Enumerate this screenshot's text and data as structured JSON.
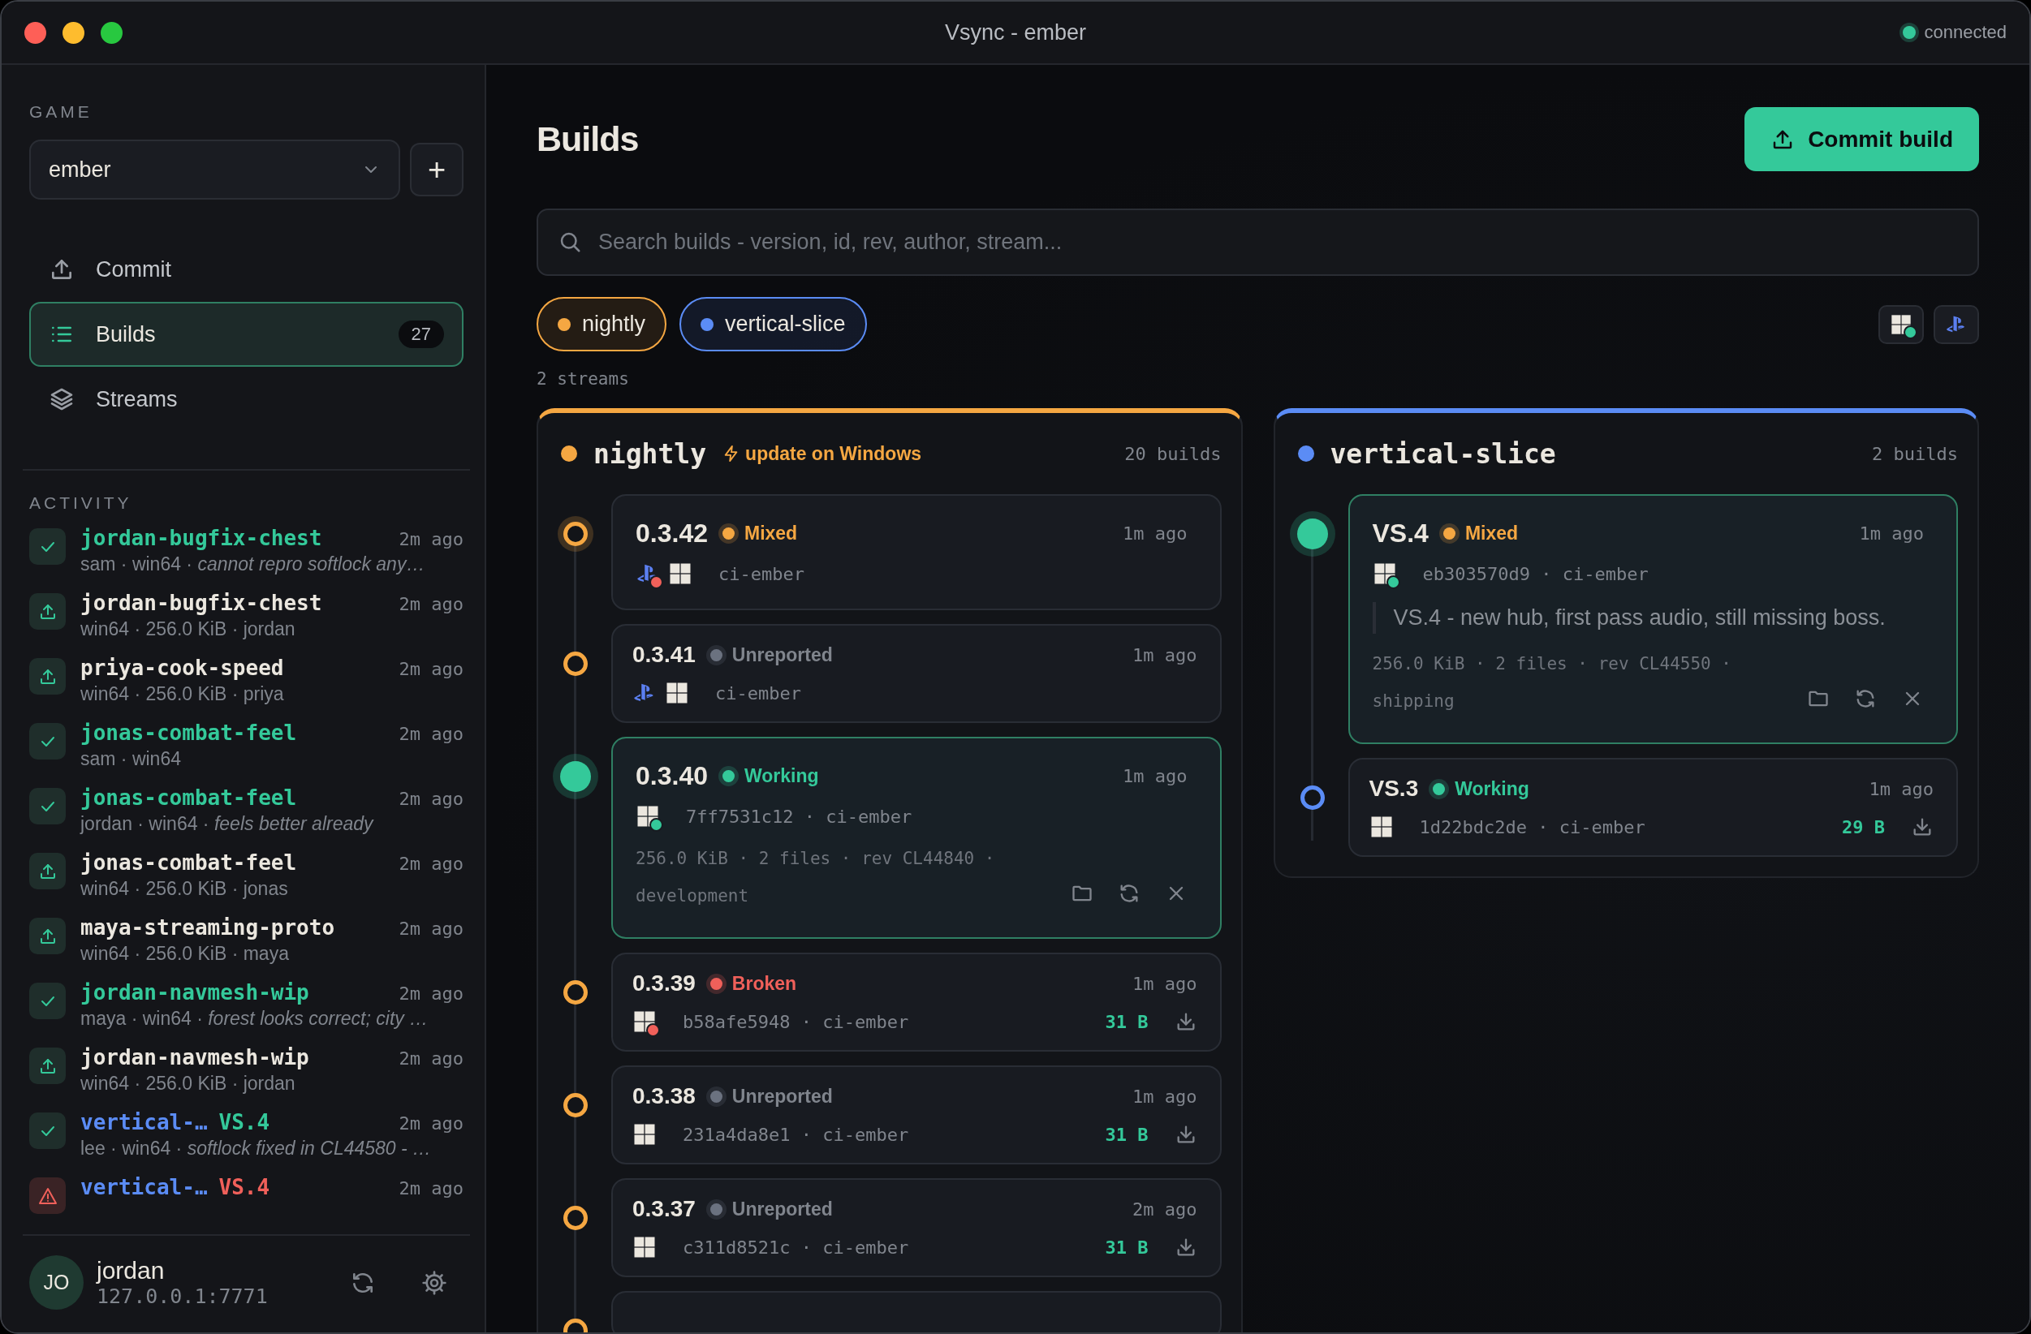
{
  "window": {
    "title": "Vsync - ember",
    "connection": {
      "label": "connected",
      "on": true
    }
  },
  "sidebar": {
    "game_label": "GAME",
    "game": {
      "value": "ember"
    },
    "add_button": "+",
    "nav": [
      {
        "label": "Commit",
        "selected": false
      },
      {
        "label": "Builds",
        "selected": true,
        "count": "27"
      },
      {
        "label": "Streams",
        "selected": false
      }
    ],
    "activity_label": "ACTIVITY",
    "activity": [
      {
        "kind": "check",
        "name": "jordan-bugfix-chest",
        "color": "#34c99a",
        "time": "2m ago",
        "meta": "sam · win64 · *cannot repro softlock any…*"
      },
      {
        "kind": "upload",
        "name": "jordan-bugfix-chest",
        "color": "#ebe7df",
        "time": "2m ago",
        "meta": "win64 · 256.0 KiB · jordan"
      },
      {
        "kind": "upload",
        "name": "priya-cook-speed",
        "color": "#ebe7df",
        "time": "2m ago",
        "meta": "win64 · 256.0 KiB · priya"
      },
      {
        "kind": "check",
        "name": "jonas-combat-feel",
        "color": "#34c99a",
        "time": "2m ago",
        "meta": "sam · win64"
      },
      {
        "kind": "check",
        "name": "jonas-combat-feel",
        "color": "#34c99a",
        "time": "2m ago",
        "meta": "jordan · win64 · *feels better already*"
      },
      {
        "kind": "upload",
        "name": "jonas-combat-feel",
        "color": "#ebe7df",
        "time": "2m ago",
        "meta": "win64 · 256.0 KiB · jonas"
      },
      {
        "kind": "upload",
        "name": "maya-streaming-proto",
        "color": "#ebe7df",
        "time": "2m ago",
        "meta": "win64 · 256.0 KiB · maya"
      },
      {
        "kind": "check",
        "name": "jordan-navmesh-wip",
        "color": "#34c99a",
        "time": "2m ago",
        "meta": "maya · win64 · *forest looks correct; city …*"
      },
      {
        "kind": "upload",
        "name": "jordan-navmesh-wip",
        "color": "#ebe7df",
        "time": "2m ago",
        "meta": "win64 · 256.0 KiB · jordan"
      },
      {
        "kind": "check",
        "name": "vertical-…",
        "version": "VS.4",
        "color": "#5b8cf5",
        "time": "2m ago",
        "meta": "lee · win64 · *softlock fixed in CL44580 - …*"
      },
      {
        "kind": "warning",
        "name": "vertical-…",
        "version": "VS.4",
        "color": "#5b8cf5",
        "time": "2m ago"
      }
    ],
    "user": {
      "initials": "JO",
      "name": "jordan",
      "address": "127.0.0.1:7771"
    }
  },
  "main": {
    "title": "Builds",
    "commit_button": "Commit build",
    "search": {
      "placeholder": "Search builds - version, id, rev, author, stream..."
    },
    "filters": [
      {
        "label": "nightly",
        "color": "#f5a742",
        "selected": true
      },
      {
        "label": "vertical-slice",
        "color": "#5b8cf5",
        "selected": true
      }
    ],
    "platform_filters": [
      {
        "kind": "windows",
        "color": "#34c99a"
      },
      {
        "kind": "playstation"
      }
    ],
    "stream_count": "2 streams",
    "streams": [
      {
        "name": "nightly",
        "color": "#f5a742",
        "update_note": "update on Windows",
        "count": "20 builds",
        "more_below": true,
        "builds": [
          {
            "version": "0.3.42",
            "status": {
              "kind": "mixed",
              "label": "Mixed"
            },
            "time": "1m ago",
            "current": false,
            "latest": true,
            "expanded": false,
            "platforms": [
              {
                "kind": "playstation",
                "color": "#f0605a"
              },
              {
                "kind": "windows"
              }
            ],
            "meta": "ci-ember"
          },
          {
            "version": "0.3.41",
            "status": {
              "kind": "unreported",
              "label": "Unreported"
            },
            "time": "1m ago",
            "current": false,
            "latest": false,
            "expanded": false,
            "platforms": [
              {
                "kind": "playstation"
              },
              {
                "kind": "windows"
              }
            ],
            "meta": "ci-ember"
          },
          {
            "version": "0.3.40",
            "status": {
              "kind": "working",
              "label": "Working"
            },
            "time": "1m ago",
            "current": true,
            "latest": false,
            "expanded": true,
            "platforms": [
              {
                "kind": "windows",
                "color": "#34c99a"
              }
            ],
            "meta": "7ff7531c12 · ci-ember",
            "details": "256.0 KiB · 2 files · rev CL44840 · development"
          },
          {
            "version": "0.3.39",
            "status": {
              "kind": "broken",
              "label": "Broken"
            },
            "time": "1m ago",
            "current": false,
            "latest": false,
            "expanded": false,
            "platforms": [
              {
                "kind": "windows",
                "color": "#f0605a"
              }
            ],
            "meta": "b58afe5948 · ci-ember",
            "size": "31 B"
          },
          {
            "version": "0.3.38",
            "status": {
              "kind": "unreported",
              "label": "Unreported"
            },
            "time": "1m ago",
            "current": false,
            "latest": false,
            "expanded": false,
            "platforms": [
              {
                "kind": "windows"
              }
            ],
            "meta": "231a4da8e1 · ci-ember",
            "size": "31 B"
          },
          {
            "version": "0.3.37",
            "status": {
              "kind": "unreported",
              "label": "Unreported"
            },
            "time": "2m ago",
            "current": false,
            "latest": false,
            "expanded": false,
            "platforms": [
              {
                "kind": "windows"
              }
            ],
            "meta": "c311d8521c · ci-ember",
            "size": "31 B"
          }
        ]
      },
      {
        "name": "vertical-slice",
        "color": "#5b8cf5",
        "count": "2 builds",
        "more_below": false,
        "builds": [
          {
            "version": "VS.4",
            "status": {
              "kind": "mixed",
              "label": "Mixed"
            },
            "time": "1m ago",
            "current": true,
            "latest": false,
            "expanded": true,
            "platforms": [
              {
                "kind": "windows",
                "color": "#34c99a"
              }
            ],
            "meta": "eb303570d9 · ci-ember",
            "note": "VS.4 - new hub, first pass audio, still missing boss.",
            "details": "256.0 KiB · 2 files · rev CL44550 · shipping"
          },
          {
            "version": "VS.3",
            "status": {
              "kind": "working",
              "label": "Working"
            },
            "time": "1m ago",
            "current": false,
            "latest": false,
            "expanded": false,
            "platforms": [
              {
                "kind": "windows"
              }
            ],
            "meta": "1d22bdc2de · ci-ember",
            "size": "29 B"
          }
        ]
      }
    ]
  }
}
